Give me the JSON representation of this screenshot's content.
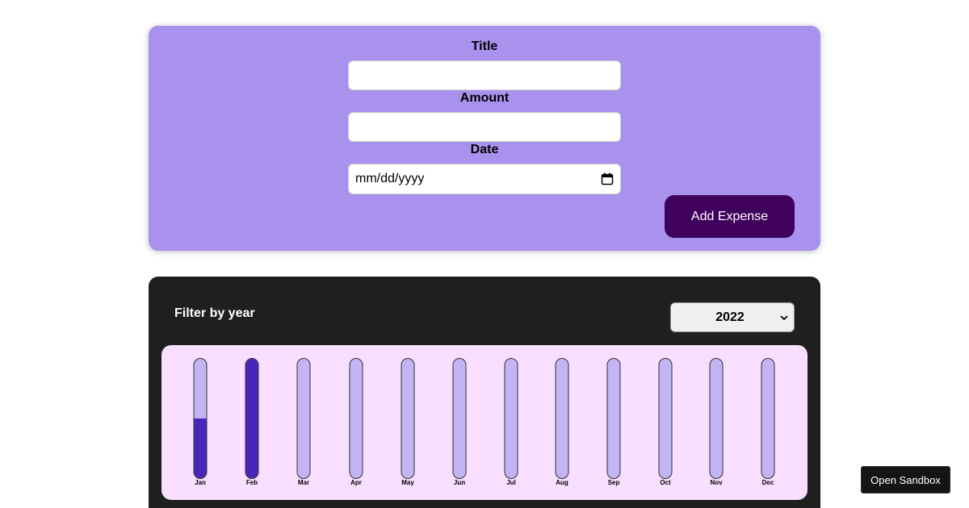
{
  "form": {
    "title_label": "Title",
    "title_value": "",
    "amount_label": "Amount",
    "amount_value": "",
    "date_label": "Date",
    "date_placeholder": "mm/dd/yyyy",
    "date_icon": "calendar-icon",
    "submit_label": "Add Expense",
    "colors": {
      "card": "#a892ee",
      "button": "#40005d"
    }
  },
  "expenses": {
    "filter_label": "Filter by year",
    "selected_year": "2022",
    "select_icon": "chevron-down-icon",
    "colors": {
      "card": "#1f1f1f",
      "chart_bg": "#f8dfff",
      "bar_empty": "#c3b4f3",
      "bar_fill": "#4826b9"
    }
  },
  "chart_data": {
    "type": "bar",
    "categories": [
      "Jan",
      "Feb",
      "Mar",
      "Apr",
      "May",
      "Jun",
      "Jul",
      "Aug",
      "Sep",
      "Oct",
      "Nov",
      "Dec"
    ],
    "values": [
      0.5,
      1.0,
      0,
      0,
      0,
      0,
      0,
      0,
      0,
      0,
      0,
      0
    ],
    "ylim": [
      0,
      1
    ]
  },
  "sandbox": {
    "label": "Open Sandbox"
  }
}
